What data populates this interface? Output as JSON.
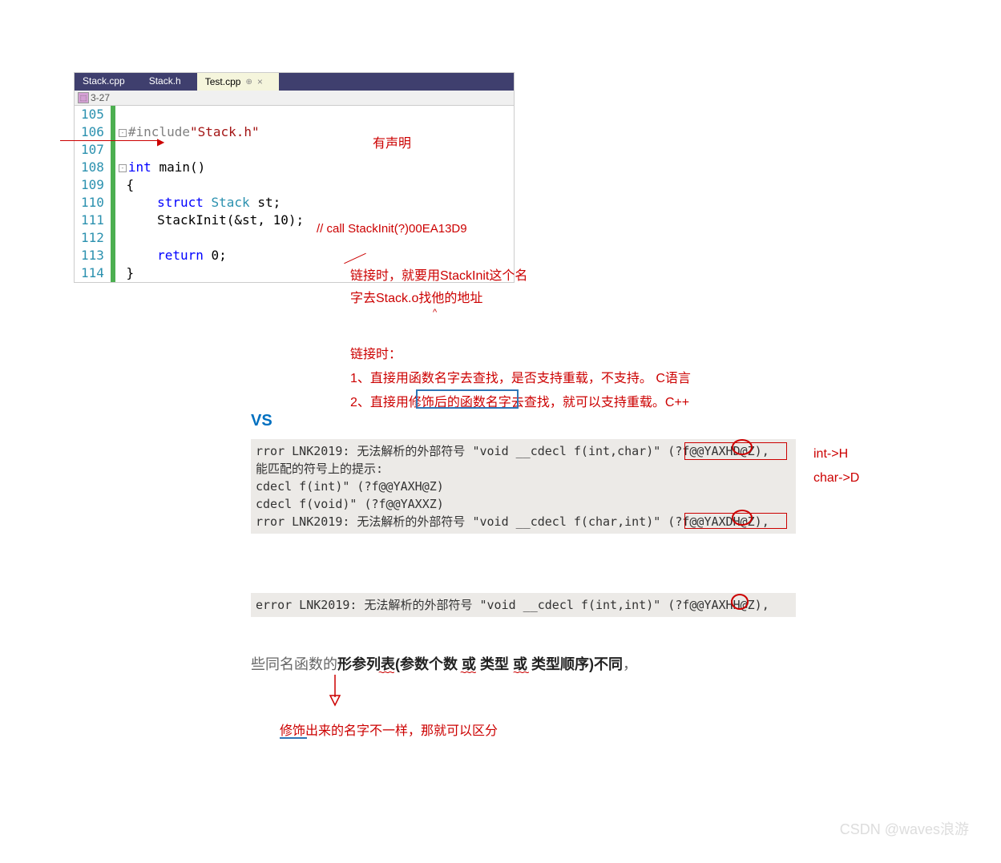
{
  "tabs": [
    {
      "label": "Stack.cpp",
      "active": false
    },
    {
      "label": "Stack.h",
      "active": false
    },
    {
      "label": "Test.cpp",
      "active": true
    }
  ],
  "nav": {
    "project": "3-27"
  },
  "code": {
    "lines": [
      {
        "num": "105",
        "raw": ""
      },
      {
        "num": "106",
        "raw": "#include\"Stack.h\""
      },
      {
        "num": "107",
        "raw": ""
      },
      {
        "num": "108",
        "raw": "int main()"
      },
      {
        "num": "109",
        "raw": "{"
      },
      {
        "num": "110",
        "raw": "    struct Stack st;"
      },
      {
        "num": "111",
        "raw": "    StackInit(&st, 10);"
      },
      {
        "num": "112",
        "raw": ""
      },
      {
        "num": "113",
        "raw": "    return 0;"
      },
      {
        "num": "114",
        "raw": "}"
      }
    ]
  },
  "annotations": {
    "has_decl": "有声明",
    "call_comment": "// call  StackInit(?)00EA13D9",
    "link_note1": "链接时，就要用StackInit这个名",
    "link_note2": "字去Stack.o找他的地址",
    "link_header": "链接时：",
    "link_rule1": "1、直接用函数名字去查找，是否支持重载，不支持。    C语言",
    "link_rule2": "2、直接用修饰后的函数名字去查找，就可以支持重载。C++",
    "vs_label": "VS",
    "type_map1": "int->H",
    "type_map2": "char->D",
    "rule_prefix": "些同名函数的",
    "rule_bold": "形参列表(参数个数 或 类型 或 类型顺序)不同",
    "rule_suffix": "，",
    "decorate_note": "修饰出来的名字不一样，那就可以区分",
    "watermark": "CSDN @waves浪游"
  },
  "errors": {
    "box1_line1": "rror LNK2019: 无法解析的外部符号 \"void __cdecl f(int,char)\" (?f@@YAXHD@Z),",
    "box1_line2": "能匹配的符号上的提示:",
    "box1_line3": "cdecl f(int)\" (?f@@YAXH@Z)",
    "box1_line4": "cdecl f(void)\" (?f@@YAXXZ)",
    "box1_line5": "rror LNK2019: 无法解析的外部符号 \"void __cdecl f(char,int)\" (?f@@YAXDH@Z),",
    "box2_line1": "error LNK2019: 无法解析的外部符号 \"void __cdecl f(int,int)\" (?f@@YAXHH@Z),"
  }
}
